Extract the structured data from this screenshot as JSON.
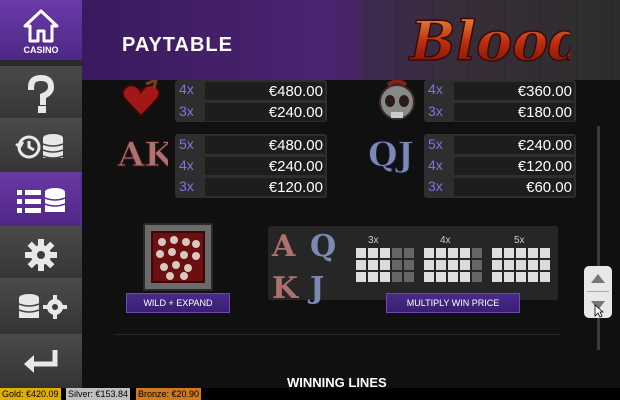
{
  "sidebar": {
    "casino_label": "CASINO"
  },
  "header": {
    "title": "PAYTABLE",
    "logo_text": "Blood"
  },
  "paytable": {
    "heart": {
      "rows": [
        {
          "mult": "4x",
          "amount": "€480.00"
        },
        {
          "mult": "3x",
          "amount": "€240.00"
        }
      ]
    },
    "skull": {
      "rows": [
        {
          "mult": "4x",
          "amount": "€360.00"
        },
        {
          "mult": "3x",
          "amount": "€180.00"
        }
      ]
    },
    "ak": {
      "letters": "AK",
      "rows": [
        {
          "mult": "5x",
          "amount": "€480.00"
        },
        {
          "mult": "4x",
          "amount": "€240.00"
        },
        {
          "mult": "3x",
          "amount": "€120.00"
        }
      ]
    },
    "qj": {
      "letters": "QJ",
      "rows": [
        {
          "mult": "5x",
          "amount": "€240.00"
        },
        {
          "mult": "4x",
          "amount": "€120.00"
        },
        {
          "mult": "3x",
          "amount": "€60.00"
        }
      ]
    }
  },
  "features": {
    "wild_label": "WILD + EXPAND",
    "multiply_label": "MULTIPLY WIN PRICE",
    "multiply_letters": [
      "A",
      "Q",
      "K",
      "J"
    ],
    "grid_labels": [
      "3x",
      "4x",
      "5x"
    ]
  },
  "section_title": "WINNING LINES",
  "status": {
    "gold": "Gold: €420.09",
    "silver": "Silver: €153.84",
    "bronze": "Bronze: €20.90"
  },
  "colors": {
    "accent": "#5a2c94",
    "multiplier": "#8a6fe0",
    "gold": "#e0b000",
    "silver": "#c0c0c0",
    "bronze": "#d07a20"
  }
}
